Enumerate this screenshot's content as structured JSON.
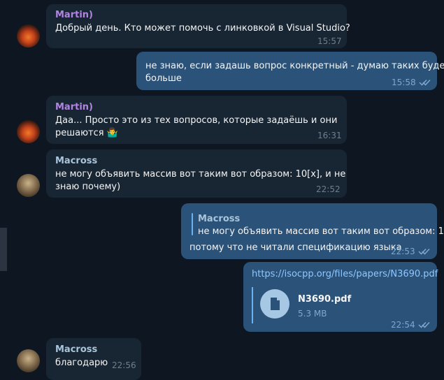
{
  "messages": [
    {
      "sender": "Martin)",
      "text": [
        "Добрый день. Кто может помочь с линковкой в Visual Studio?"
      ],
      "time": "15:57"
    },
    {
      "text": [
        "не знаю, если задашь вопрос конкретный - думаю таких будет",
        "больше"
      ],
      "time": "15:58"
    },
    {
      "sender": "Martin)",
      "text": [
        "Даа... Просто это из тех вопросов, которые задаёшь и они",
        "решаются 🤷‍♂️"
      ],
      "time": "16:31"
    },
    {
      "sender": "Macross",
      "text": [
        "не могу объявить массив вот таким вот образом: 10[x], и не",
        "знаю почему)"
      ],
      "time": "22:52"
    },
    {
      "quote_sender": "Macross",
      "quote_text": "не могу объявить массив вот таким вот образом: 1...",
      "text": [
        "потому что не читали спецификацию языка"
      ],
      "time": "22:53"
    },
    {
      "link": "https://isocpp.org/files/papers/N3690.pdf",
      "file_name": "N3690.pdf",
      "file_size": "5.3 MB",
      "time": "22:54"
    },
    {
      "sender": "Macross",
      "text": [
        "благодарю"
      ],
      "time": "22:56"
    }
  ],
  "icons": {
    "read": "double-check-icon",
    "file": "document-icon"
  },
  "colors": {
    "background": "#0e1621",
    "incoming": "#182533",
    "outgoing": "#2b5278",
    "accent": "#6ab2f2"
  }
}
